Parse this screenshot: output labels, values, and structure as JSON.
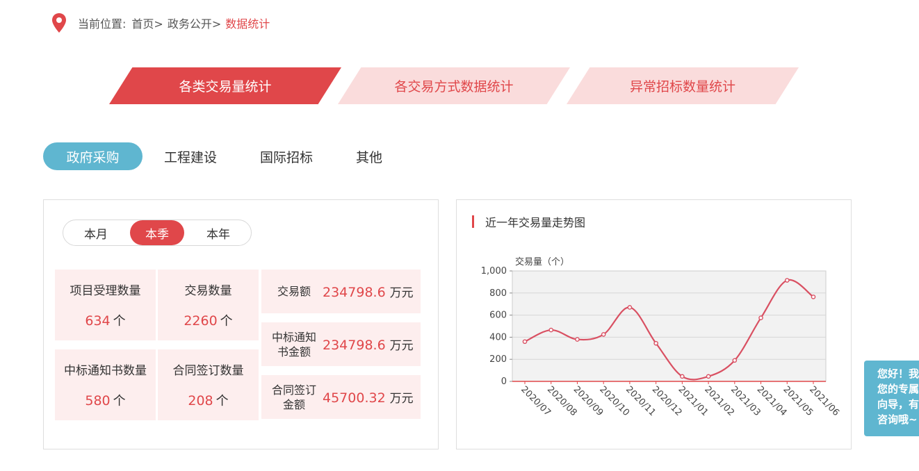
{
  "breadcrumb": {
    "prefix": "当前位置:",
    "home": "首页>",
    "section": "政务公开>",
    "current": "数据统计"
  },
  "top_tabs": [
    {
      "label": "各类交易量统计",
      "active": true
    },
    {
      "label": "各交易方式数据统计",
      "active": false
    },
    {
      "label": "异常招标数量统计",
      "active": false
    }
  ],
  "category_tabs": [
    {
      "label": "政府采购",
      "active": true
    },
    {
      "label": "工程建设",
      "active": false
    },
    {
      "label": "国际招标",
      "active": false
    },
    {
      "label": "其他",
      "active": false
    }
  ],
  "period": {
    "options": [
      "本月",
      "本季",
      "本年"
    ],
    "selected": "本季"
  },
  "stats": {
    "project_accept": {
      "label": "项目受理数量",
      "value": "634",
      "unit": "个"
    },
    "trade_count": {
      "label": "交易数量",
      "value": "2260",
      "unit": "个"
    },
    "notice_count": {
      "label": "中标通知书数量",
      "value": "580",
      "unit": "个"
    },
    "contract_count": {
      "label": "合同签订数量",
      "value": "208",
      "unit": "个"
    },
    "trade_amount": {
      "label": "交易额",
      "value": "234798.6",
      "unit": "万元"
    },
    "notice_amount": {
      "label_line1": "中标通知",
      "label_line2": "书金额",
      "value": "234798.6",
      "unit": "万元"
    },
    "contract_amount": {
      "label_line1": "合同签订",
      "label_line2": "金额",
      "value": "45700.32",
      "unit": "万元"
    }
  },
  "chart_panel": {
    "title": "近一年交易量走势图"
  },
  "chart_data": {
    "type": "line",
    "ylabel": "交易量（个）",
    "ylim": [
      0,
      1000
    ],
    "yticks": [
      "0",
      "200",
      "400",
      "600",
      "800",
      "1,000"
    ],
    "ytick_values": [
      0,
      200,
      400,
      600,
      800,
      1000
    ],
    "x": [
      "2020/07",
      "2020/08",
      "2020/09",
      "2020/10",
      "2020/11",
      "2020/12",
      "2021/01",
      "2021/02",
      "2021/03",
      "2021/04",
      "2021/05",
      "2021/06"
    ],
    "values": [
      360,
      465,
      380,
      425,
      670,
      345,
      45,
      45,
      190,
      575,
      915,
      765
    ],
    "grid": true,
    "line_color": "#d95062"
  },
  "chat": {
    "lines": [
      "您好！我",
      "您的专属",
      "向导，有",
      "咨询哦~"
    ]
  },
  "colors": {
    "accent": "#e0474a",
    "accent_light": "#fadcdc",
    "teal": "#5fb6d0"
  }
}
